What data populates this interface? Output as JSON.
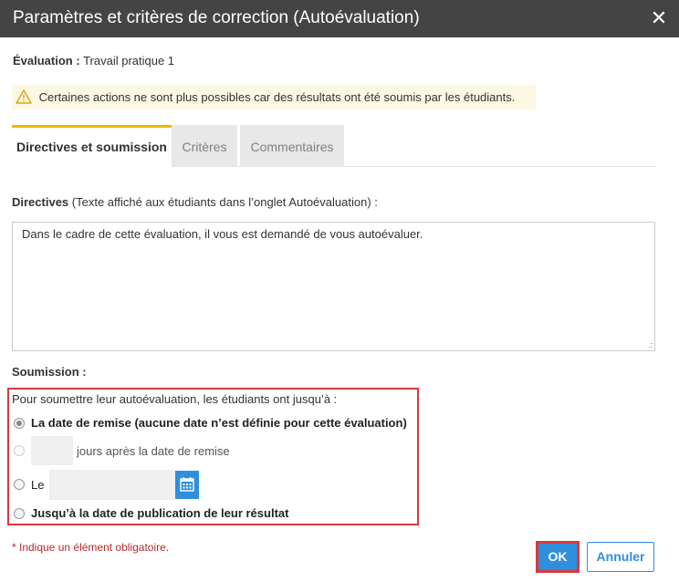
{
  "dialog": {
    "title": "Paramètres et critères de correction (Autoévaluation)",
    "close_glyph": "✕"
  },
  "evaluation": {
    "label": "Évaluation :",
    "value": "Travail pratique 1"
  },
  "warning": {
    "icon": "warning-icon",
    "text": "Certaines actions ne sont plus possibles car des résultats ont été soumis par les étudiants."
  },
  "tabs": [
    {
      "label": "Directives et soumission",
      "active": true
    },
    {
      "label": "Critères",
      "active": false
    },
    {
      "label": "Commentaires",
      "active": false
    }
  ],
  "directives": {
    "label": "Directives",
    "hint": "(Texte affiché aux étudiants dans l’onglet Autoévaluation) :",
    "value": "Dans le cadre de cette évaluation, il vous est demandé de vous autoévaluer."
  },
  "submission": {
    "label": "Soumission :",
    "intro": "Pour soumettre leur autoévaluation, les étudiants ont jusqu’à :",
    "options": [
      {
        "label": "La date de remise (aucune date n’est définie pour cette évaluation)",
        "selected": true
      },
      {
        "label": "jours après la date de remise",
        "selected": false,
        "disabled": true,
        "days_value": ""
      },
      {
        "label": "Le",
        "selected": false,
        "date_value": ""
      },
      {
        "label": "Jusqu’à la date de publication de leur résultat",
        "selected": false
      }
    ],
    "calendar_icon": "calendar-icon"
  },
  "footer": {
    "required_note": "* Indique un élément obligatoire.",
    "ok_label": "OK",
    "cancel_label": "Annuler"
  },
  "colors": {
    "titlebar": "#444444",
    "accent_tab": "#f2b705",
    "primary": "#2f8fdc",
    "highlight_border": "#d9393e",
    "warning_bg": "#fcf8e3",
    "required_text": "#b52b2b"
  }
}
